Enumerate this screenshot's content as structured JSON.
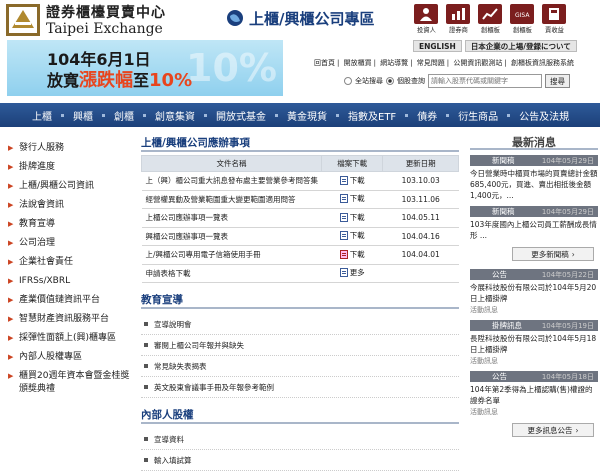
{
  "header": {
    "logo_zh": "證券櫃檯買賣中心",
    "logo_en": "Taipei Exchange",
    "page_title": "上櫃/興櫃公司專區",
    "top_icons": [
      {
        "label": "投資人",
        "icon": "person-icon"
      },
      {
        "label": "證券商",
        "icon": "chart-icon"
      },
      {
        "label": "創櫃板",
        "icon": "trend-icon"
      },
      {
        "label": "創櫃板",
        "icon": "gisa-icon"
      },
      {
        "label": "賣收益",
        "icon": "calculator-icon"
      }
    ],
    "banner": {
      "line1": "104年6月1日",
      "line2_pre": "放寬",
      "line2_hl": "漲跌幅",
      "line2_post": "至",
      "line2_num": "10%"
    },
    "lang_buttons": [
      "ENGLISH",
      "日本企業の上場/登録について"
    ],
    "links": [
      "回首頁",
      "開放櫃買",
      "網站導覽",
      "常見問題",
      "公開資訊觀測站",
      "創櫃板資訊服務系統"
    ],
    "search": {
      "radio1": "全站搜尋",
      "radio2": "個股查詢",
      "placeholder": "請輸入股票代碼或關鍵字",
      "button": "搜尋"
    }
  },
  "nav": [
    "上櫃",
    "興櫃",
    "創櫃",
    "創意集資",
    "開放式基金",
    "黃金現貨",
    "指數及ETF",
    "債券",
    "衍生商品",
    "公告及法規"
  ],
  "sidebar": [
    "發行人服務",
    "掛牌進度",
    "上櫃/興櫃公司資訊",
    "法說會資訊",
    "教育宣導",
    "公司治理",
    "企業社會責任",
    "IFRSs/XBRL",
    "產業價值鏈資訊平台",
    "智慧財產資訊服務平台",
    "採彈性面額上(興)櫃專區",
    "內部人股權專區",
    "櫃買20週年資本會暨金桂獎頒獎典禮"
  ],
  "main": {
    "section1_title": "上櫃/興櫃公司應辦事項",
    "table_headers": [
      "文件名稱",
      "檔案下載",
      "更新日期"
    ],
    "rows": [
      {
        "name": "上（興）櫃公司重大訊息發布處主要營業參考問答集",
        "dl": "下載",
        "type": "doc",
        "date": "103.10.03"
      },
      {
        "name": "經營權異動及營業範圍重大變更範圍適用問答",
        "dl": "下載",
        "type": "doc",
        "date": "103.11.06"
      },
      {
        "name": "上櫃公司應辦事項一覽表",
        "dl": "下載",
        "type": "doc",
        "date": "104.05.11"
      },
      {
        "name": "興櫃公司應辦事項一覽表",
        "dl": "下載",
        "type": "doc",
        "date": "104.04.16"
      },
      {
        "name": "上/興櫃公司專用電子信箱使用手冊",
        "dl": "下載",
        "type": "pdf",
        "date": "104.04.01"
      },
      {
        "name": "申請表格下載",
        "dl": "更多",
        "type": "doc",
        "date": ""
      }
    ],
    "section2_title": "教育宣導",
    "edu_items": [
      "宣導說明會",
      "審閱上櫃公司年報并與缺失",
      "常見缺失表揭表",
      "英文股東會議事手冊及年報參考範例"
    ],
    "section3_title": "內部人股權",
    "insider_items": [
      "宣導資料",
      "輸入填試算"
    ]
  },
  "news": {
    "title": "最新消息",
    "items": [
      {
        "cat": "新聞稿",
        "date": "104年05月29日",
        "text": "今日營業時中櫃買市場的買賣總計金額685,400元，買進、賣出相抵後金額1,400元，...",
        "sub": ""
      },
      {
        "cat": "新聞稿",
        "date": "104年05月29日",
        "text": "103年度國內上櫃公司員工薪酬成長情形 ...",
        "sub": ""
      }
    ],
    "more1": "更多新聞稿",
    "notices": [
      {
        "cat": "公告",
        "date": "104年05月22日",
        "text": "今展科技股份有限公司於104年5月20日上櫃掛牌",
        "sub": "活動訊息"
      },
      {
        "cat": "掛牌訊息",
        "date": "104年05月19日",
        "text": "長陞科技股份有限公司於104年5月18日上櫃掛牌",
        "sub": "活動訊息"
      },
      {
        "cat": "公告",
        "date": "104年05月18日",
        "text": "104年第2季得為上櫃認購(售)權證的證券名單",
        "sub": "活動訊息"
      }
    ],
    "more2": "更多訊息公告"
  },
  "colors": {
    "nav": "#1c4079",
    "title": "#1a3f7d",
    "accent": "#e8451e",
    "icon_bg": "#7b1e1e"
  }
}
